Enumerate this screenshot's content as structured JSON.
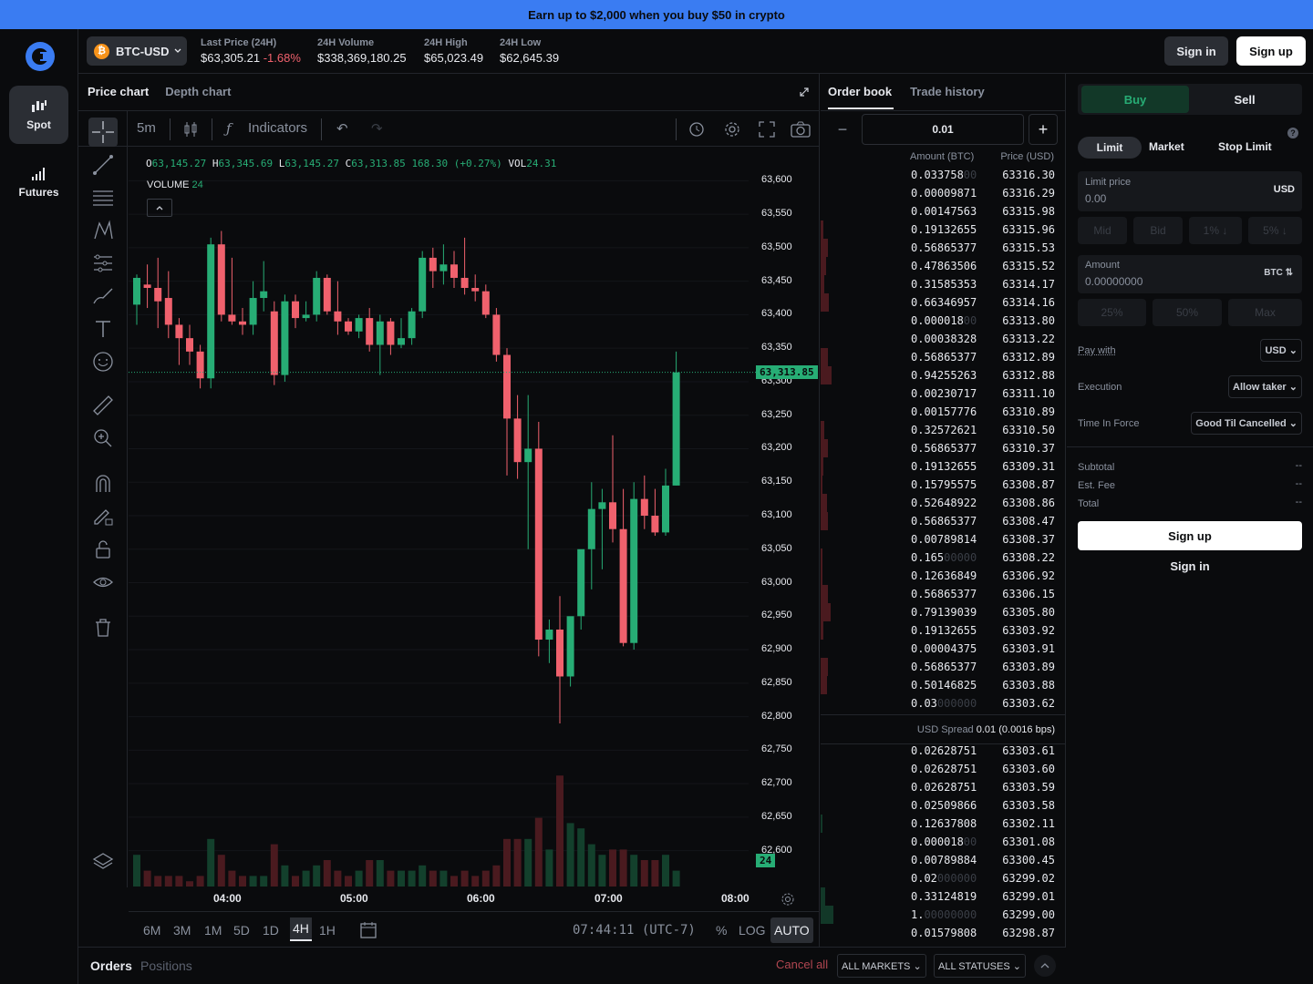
{
  "promo": "Earn up to $2,000 when you buy $50 in crypto",
  "nav": {
    "spot": "Spot",
    "futures": "Futures"
  },
  "header": {
    "pair": "BTC-USD",
    "btc_symbol": "₿",
    "last_price_label": "Last Price (24H)",
    "last_price": "$63,305.21",
    "last_change": "-1.68%",
    "volume_label": "24H Volume",
    "volume": "$338,369,180.25",
    "high_label": "24H High",
    "high": "$65,023.49",
    "low_label": "24H Low",
    "low": "$62,645.39",
    "sign_in": "Sign in",
    "sign_up": "Sign up"
  },
  "chart_panel": {
    "tab_price": "Price chart",
    "tab_depth": "Depth chart",
    "interval": "5m",
    "indicators": "Indicators",
    "ohlc": {
      "o_lbl": "O",
      "o": "63,145.27",
      "h_lbl": "H",
      "h": "63,345.69",
      "l_lbl": "L",
      "l": "63,145.27",
      "c_lbl": "C",
      "c": "63,313.85",
      "chg": "168.30 (+0.27%)",
      "vol_lbl": "VOL",
      "vol": "24.31"
    },
    "volume_label": "VOLUME",
    "volume_value": "24",
    "price_tag": "63,313.85",
    "vol_tag": "24",
    "ranges": [
      "6M",
      "3M",
      "1M",
      "5D",
      "1D",
      "4H",
      "1H"
    ],
    "active_range": "4H",
    "clock": "07:44:11 (UTC-7)",
    "pct": "%",
    "log": "LOG",
    "auto": "AUTO"
  },
  "chart_data": {
    "type": "candlestick",
    "y_ticks": [
      "63,600",
      "63,550",
      "63,500",
      "63,450",
      "63,400",
      "63,350",
      "63,300",
      "63,250",
      "63,200",
      "63,150",
      "63,100",
      "63,050",
      "63,000",
      "62,950",
      "62,900",
      "62,850",
      "62,800",
      "62,750",
      "62,700",
      "62,650",
      "62,600"
    ],
    "x_ticks": [
      "04:00",
      "05:00",
      "06:00",
      "07:00",
      "08:00"
    ],
    "ylim": [
      62590,
      63610
    ],
    "candles": [
      {
        "o": 63415,
        "h": 63460,
        "l": 63385,
        "c": 63455,
        "v": 6
      },
      {
        "o": 63445,
        "h": 63475,
        "l": 63410,
        "c": 63440,
        "v": 3
      },
      {
        "o": 63440,
        "h": 63485,
        "l": 63380,
        "c": 63420,
        "v": 2
      },
      {
        "o": 63425,
        "h": 63465,
        "l": 63365,
        "c": 63385,
        "v": 2
      },
      {
        "o": 63385,
        "h": 63395,
        "l": 63325,
        "c": 63365,
        "v": 2
      },
      {
        "o": 63365,
        "h": 63385,
        "l": 63325,
        "c": 63345,
        "v": 1
      },
      {
        "o": 63345,
        "h": 63355,
        "l": 63290,
        "c": 63305,
        "v": 2
      },
      {
        "o": 63305,
        "h": 63515,
        "l": 63290,
        "c": 63505,
        "v": 9
      },
      {
        "o": 63505,
        "h": 63525,
        "l": 63390,
        "c": 63400,
        "v": 6
      },
      {
        "o": 63400,
        "h": 63485,
        "l": 63385,
        "c": 63390,
        "v": 3
      },
      {
        "o": 63390,
        "h": 63410,
        "l": 63370,
        "c": 63385,
        "v": 2
      },
      {
        "o": 63385,
        "h": 63450,
        "l": 63370,
        "c": 63425,
        "v": 2
      },
      {
        "o": 63425,
        "h": 63480,
        "l": 63405,
        "c": 63435,
        "v": 2
      },
      {
        "o": 63405,
        "h": 63420,
        "l": 63295,
        "c": 63310,
        "v": 8
      },
      {
        "o": 63310,
        "h": 63430,
        "l": 63300,
        "c": 63420,
        "v": 4
      },
      {
        "o": 63420,
        "h": 63430,
        "l": 63380,
        "c": 63395,
        "v": 2
      },
      {
        "o": 63395,
        "h": 63420,
        "l": 63390,
        "c": 63400,
        "v": 3
      },
      {
        "o": 63400,
        "h": 63465,
        "l": 63390,
        "c": 63455,
        "v": 4
      },
      {
        "o": 63455,
        "h": 63460,
        "l": 63400,
        "c": 63405,
        "v": 5
      },
      {
        "o": 63405,
        "h": 63450,
        "l": 63370,
        "c": 63390,
        "v": 3
      },
      {
        "o": 63390,
        "h": 63395,
        "l": 63370,
        "c": 63375,
        "v": 2
      },
      {
        "o": 63375,
        "h": 63400,
        "l": 63365,
        "c": 63395,
        "v": 3
      },
      {
        "o": 63395,
        "h": 63410,
        "l": 63345,
        "c": 63355,
        "v": 5
      },
      {
        "o": 63355,
        "h": 63400,
        "l": 63310,
        "c": 63390,
        "v": 5
      },
      {
        "o": 63390,
        "h": 63395,
        "l": 63340,
        "c": 63355,
        "v": 3
      },
      {
        "o": 63355,
        "h": 63395,
        "l": 63350,
        "c": 63365,
        "v": 3
      },
      {
        "o": 63365,
        "h": 63410,
        "l": 63355,
        "c": 63405,
        "v": 3
      },
      {
        "o": 63405,
        "h": 63495,
        "l": 63395,
        "c": 63485,
        "v": 4
      },
      {
        "o": 63485,
        "h": 63500,
        "l": 63440,
        "c": 63465,
        "v": 3
      },
      {
        "o": 63465,
        "h": 63505,
        "l": 63445,
        "c": 63475,
        "v": 3
      },
      {
        "o": 63475,
        "h": 63495,
        "l": 63440,
        "c": 63455,
        "v": 2
      },
      {
        "o": 63455,
        "h": 63515,
        "l": 63430,
        "c": 63440,
        "v": 3
      },
      {
        "o": 63440,
        "h": 63460,
        "l": 63420,
        "c": 63435,
        "v": 2
      },
      {
        "o": 63435,
        "h": 63445,
        "l": 63395,
        "c": 63400,
        "v": 3
      },
      {
        "o": 63400,
        "h": 63410,
        "l": 63330,
        "c": 63340,
        "v": 4
      },
      {
        "o": 63340,
        "h": 63350,
        "l": 63160,
        "c": 63245,
        "v": 9
      },
      {
        "o": 63245,
        "h": 63280,
        "l": 63155,
        "c": 63180,
        "v": 9
      },
      {
        "o": 63180,
        "h": 63280,
        "l": 63050,
        "c": 63200,
        "v": 9
      },
      {
        "o": 63200,
        "h": 63240,
        "l": 62890,
        "c": 62915,
        "v": 13
      },
      {
        "o": 62915,
        "h": 62945,
        "l": 62880,
        "c": 62930,
        "v": 7
      },
      {
        "o": 62930,
        "h": 62980,
        "l": 62790,
        "c": 62860,
        "v": 21
      },
      {
        "o": 62860,
        "h": 62940,
        "l": 62845,
        "c": 62950,
        "v": 12
      },
      {
        "o": 62950,
        "h": 63010,
        "l": 62930,
        "c": 63050,
        "v": 11
      },
      {
        "o": 63050,
        "h": 63150,
        "l": 62990,
        "c": 63110,
        "v": 8
      },
      {
        "o": 63110,
        "h": 63140,
        "l": 63020,
        "c": 63120,
        "v": 6
      },
      {
        "o": 63120,
        "h": 63220,
        "l": 63060,
        "c": 63080,
        "v": 7
      },
      {
        "o": 63080,
        "h": 63140,
        "l": 62905,
        "c": 62910,
        "v": 7
      },
      {
        "o": 62910,
        "h": 63150,
        "l": 62900,
        "c": 63125,
        "v": 6
      },
      {
        "o": 63125,
        "h": 63160,
        "l": 63080,
        "c": 63100,
        "v": 5
      },
      {
        "o": 63100,
        "h": 63140,
        "l": 63070,
        "c": 63075,
        "v": 5
      },
      {
        "o": 63075,
        "h": 63170,
        "l": 63070,
        "c": 63145,
        "v": 6
      },
      {
        "o": 63145,
        "h": 63345,
        "l": 63145,
        "c": 63314,
        "v": 3
      }
    ]
  },
  "orderbook": {
    "tab_book": "Order book",
    "tab_trades": "Trade history",
    "increment": "0.01",
    "col_amount": "Amount (BTC)",
    "col_price": "Price (USD)",
    "asks": [
      {
        "a": "0.033758",
        "d": "00",
        "p": "63316.30",
        "w": 0
      },
      {
        "a": "0.00009871",
        "d": "",
        "p": "63316.29",
        "w": 0
      },
      {
        "a": "0.00147563",
        "d": "",
        "p": "63315.98",
        "w": 0
      },
      {
        "a": "0.19132655",
        "d": "",
        "p": "63315.96",
        "w": 3
      },
      {
        "a": "0.56865377",
        "d": "",
        "p": "63315.53",
        "w": 8
      },
      {
        "a": "0.47863506",
        "d": "",
        "p": "63315.52",
        "w": 6
      },
      {
        "a": "0.31585353",
        "d": "",
        "p": "63314.17",
        "w": 4
      },
      {
        "a": "0.66346957",
        "d": "",
        "p": "63314.16",
        "w": 9
      },
      {
        "a": "0.000018",
        "d": "00",
        "p": "63313.80",
        "w": 0
      },
      {
        "a": "0.00038328",
        "d": "",
        "p": "63313.22",
        "w": 0
      },
      {
        "a": "0.56865377",
        "d": "",
        "p": "63312.89",
        "w": 8
      },
      {
        "a": "0.94255263",
        "d": "",
        "p": "63312.88",
        "w": 12
      },
      {
        "a": "0.00230717",
        "d": "",
        "p": "63311.10",
        "w": 0
      },
      {
        "a": "0.00157776",
        "d": "",
        "p": "63310.89",
        "w": 0
      },
      {
        "a": "0.32572621",
        "d": "",
        "p": "63310.50",
        "w": 4
      },
      {
        "a": "0.56865377",
        "d": "",
        "p": "63310.37",
        "w": 8
      },
      {
        "a": "0.19132655",
        "d": "",
        "p": "63309.31",
        "w": 3
      },
      {
        "a": "0.15795575",
        "d": "",
        "p": "63308.87",
        "w": 2
      },
      {
        "a": "0.52648922",
        "d": "",
        "p": "63308.86",
        "w": 7
      },
      {
        "a": "0.56865377",
        "d": "",
        "p": "63308.47",
        "w": 8
      },
      {
        "a": "0.00789814",
        "d": "",
        "p": "63308.37",
        "w": 0
      },
      {
        "a": "0.165",
        "d": "00000",
        "p": "63308.22",
        "w": 2
      },
      {
        "a": "0.12636849",
        "d": "",
        "p": "63306.92",
        "w": 2
      },
      {
        "a": "0.56865377",
        "d": "",
        "p": "63306.15",
        "w": 8
      },
      {
        "a": "0.79139039",
        "d": "",
        "p": "63305.80",
        "w": 11
      },
      {
        "a": "0.19132655",
        "d": "",
        "p": "63303.92",
        "w": 3
      },
      {
        "a": "0.00004375",
        "d": "",
        "p": "63303.91",
        "w": 0
      },
      {
        "a": "0.56865377",
        "d": "",
        "p": "63303.89",
        "w": 8
      },
      {
        "a": "0.50146825",
        "d": "",
        "p": "63303.88",
        "w": 7
      },
      {
        "a": "0.03",
        "d": "000000",
        "p": "63303.62",
        "w": 0
      }
    ],
    "spread_label": "USD Spread",
    "spread_value": "0.01",
    "spread_bps": "(0.0016 bps)",
    "bids": [
      {
        "a": "0.02628751",
        "d": "",
        "p": "63303.61",
        "w": 0
      },
      {
        "a": "0.02628751",
        "d": "",
        "p": "63303.60",
        "w": 0
      },
      {
        "a": "0.02628751",
        "d": "",
        "p": "63303.59",
        "w": 0
      },
      {
        "a": "0.02509866",
        "d": "",
        "p": "63303.58",
        "w": 0
      },
      {
        "a": "0.12637808",
        "d": "",
        "p": "63302.11",
        "w": 2
      },
      {
        "a": "0.000018",
        "d": "00",
        "p": "63301.08",
        "w": 0
      },
      {
        "a": "0.00789884",
        "d": "",
        "p": "63300.45",
        "w": 0
      },
      {
        "a": "0.02",
        "d": "000000",
        "p": "63299.02",
        "w": 0
      },
      {
        "a": "0.33124819",
        "d": "",
        "p": "63299.01",
        "w": 5
      },
      {
        "a": "1.",
        "d": "00000000",
        "p": "63299.00",
        "w": 14
      },
      {
        "a": "0.01579808",
        "d": "",
        "p": "63298.87",
        "w": 0
      }
    ]
  },
  "orderform": {
    "buy": "Buy",
    "sell": "Sell",
    "types": [
      "Limit",
      "Market",
      "Stop Limit"
    ],
    "limit_price_label": "Limit price",
    "limit_price": "0.00",
    "limit_currency": "USD",
    "quick_price": [
      "Mid",
      "Bid",
      "1% ↓",
      "5% ↓"
    ],
    "amount_label": "Amount",
    "amount_value": "0.00000000",
    "amount_currency": "BTC ⇅",
    "quick_amount": [
      "25%",
      "50%",
      "Max"
    ],
    "pay_with_label": "Pay with",
    "pay_with": "USD",
    "execution_label": "Execution",
    "execution": "Allow taker",
    "tif_label": "Time In Force",
    "tif": "Good Til Cancelled",
    "subtotal_label": "Subtotal",
    "subtotal": "--",
    "fee_label": "Est. Fee",
    "fee": "--",
    "total_label": "Total",
    "total": "--",
    "sign_up": "Sign up",
    "sign_in": "Sign in",
    "help": "?"
  },
  "orders_bar": {
    "orders": "Orders",
    "positions": "Positions",
    "cancel_all": "Cancel all",
    "all_markets": "ALL MARKETS",
    "all_statuses": "ALL STATUSES"
  },
  "colors": {
    "up": "#27ad75",
    "down": "#f0616d",
    "accent": "#3a7cf2"
  }
}
